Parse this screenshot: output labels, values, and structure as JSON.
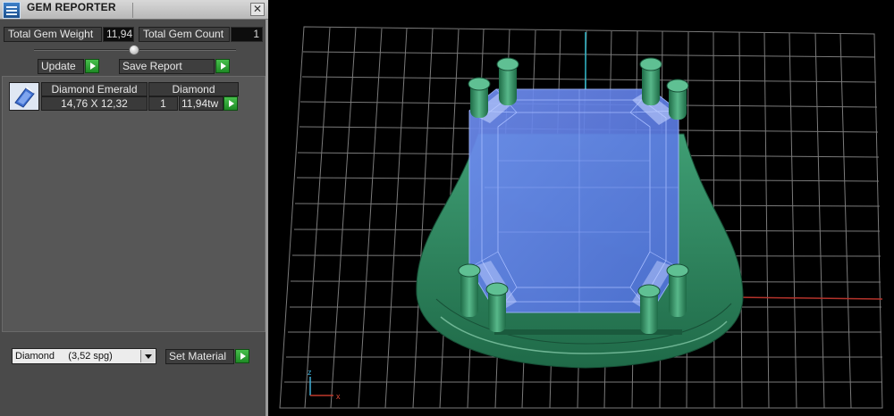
{
  "window": {
    "title": "GEM REPORTER",
    "close_glyph": "✕"
  },
  "stats": {
    "total_weight_label": "Total Gem Weight",
    "total_weight_value": "11,94",
    "total_count_label": "Total Gem Count",
    "total_count_value": "1"
  },
  "actions": {
    "update_label": "Update",
    "save_report_label": "Save Report"
  },
  "gem_table": {
    "rows": [
      {
        "name": "Diamond Emerald",
        "material": "Diamond",
        "size": "14,76 X 12,32",
        "count": "1",
        "weight": "11,94tw"
      }
    ]
  },
  "material": {
    "selected": "Diamond     (3,52 spg)",
    "set_label": "Set Material"
  },
  "viewport": {
    "axis_z": "z",
    "axis_x": "x"
  },
  "colors": {
    "accent_green": "#2aa12f",
    "ring_green": "#2f8a62",
    "gem_blue": "#5a7ee0",
    "grid": "#7a7a7a"
  },
  "icons": {
    "app": "gem-reporter-app-icon",
    "close": "close-icon",
    "run": "green-play-arrow-icon",
    "gem": "gem-thumbnail-icon",
    "dropdown": "chevron-down-icon"
  }
}
